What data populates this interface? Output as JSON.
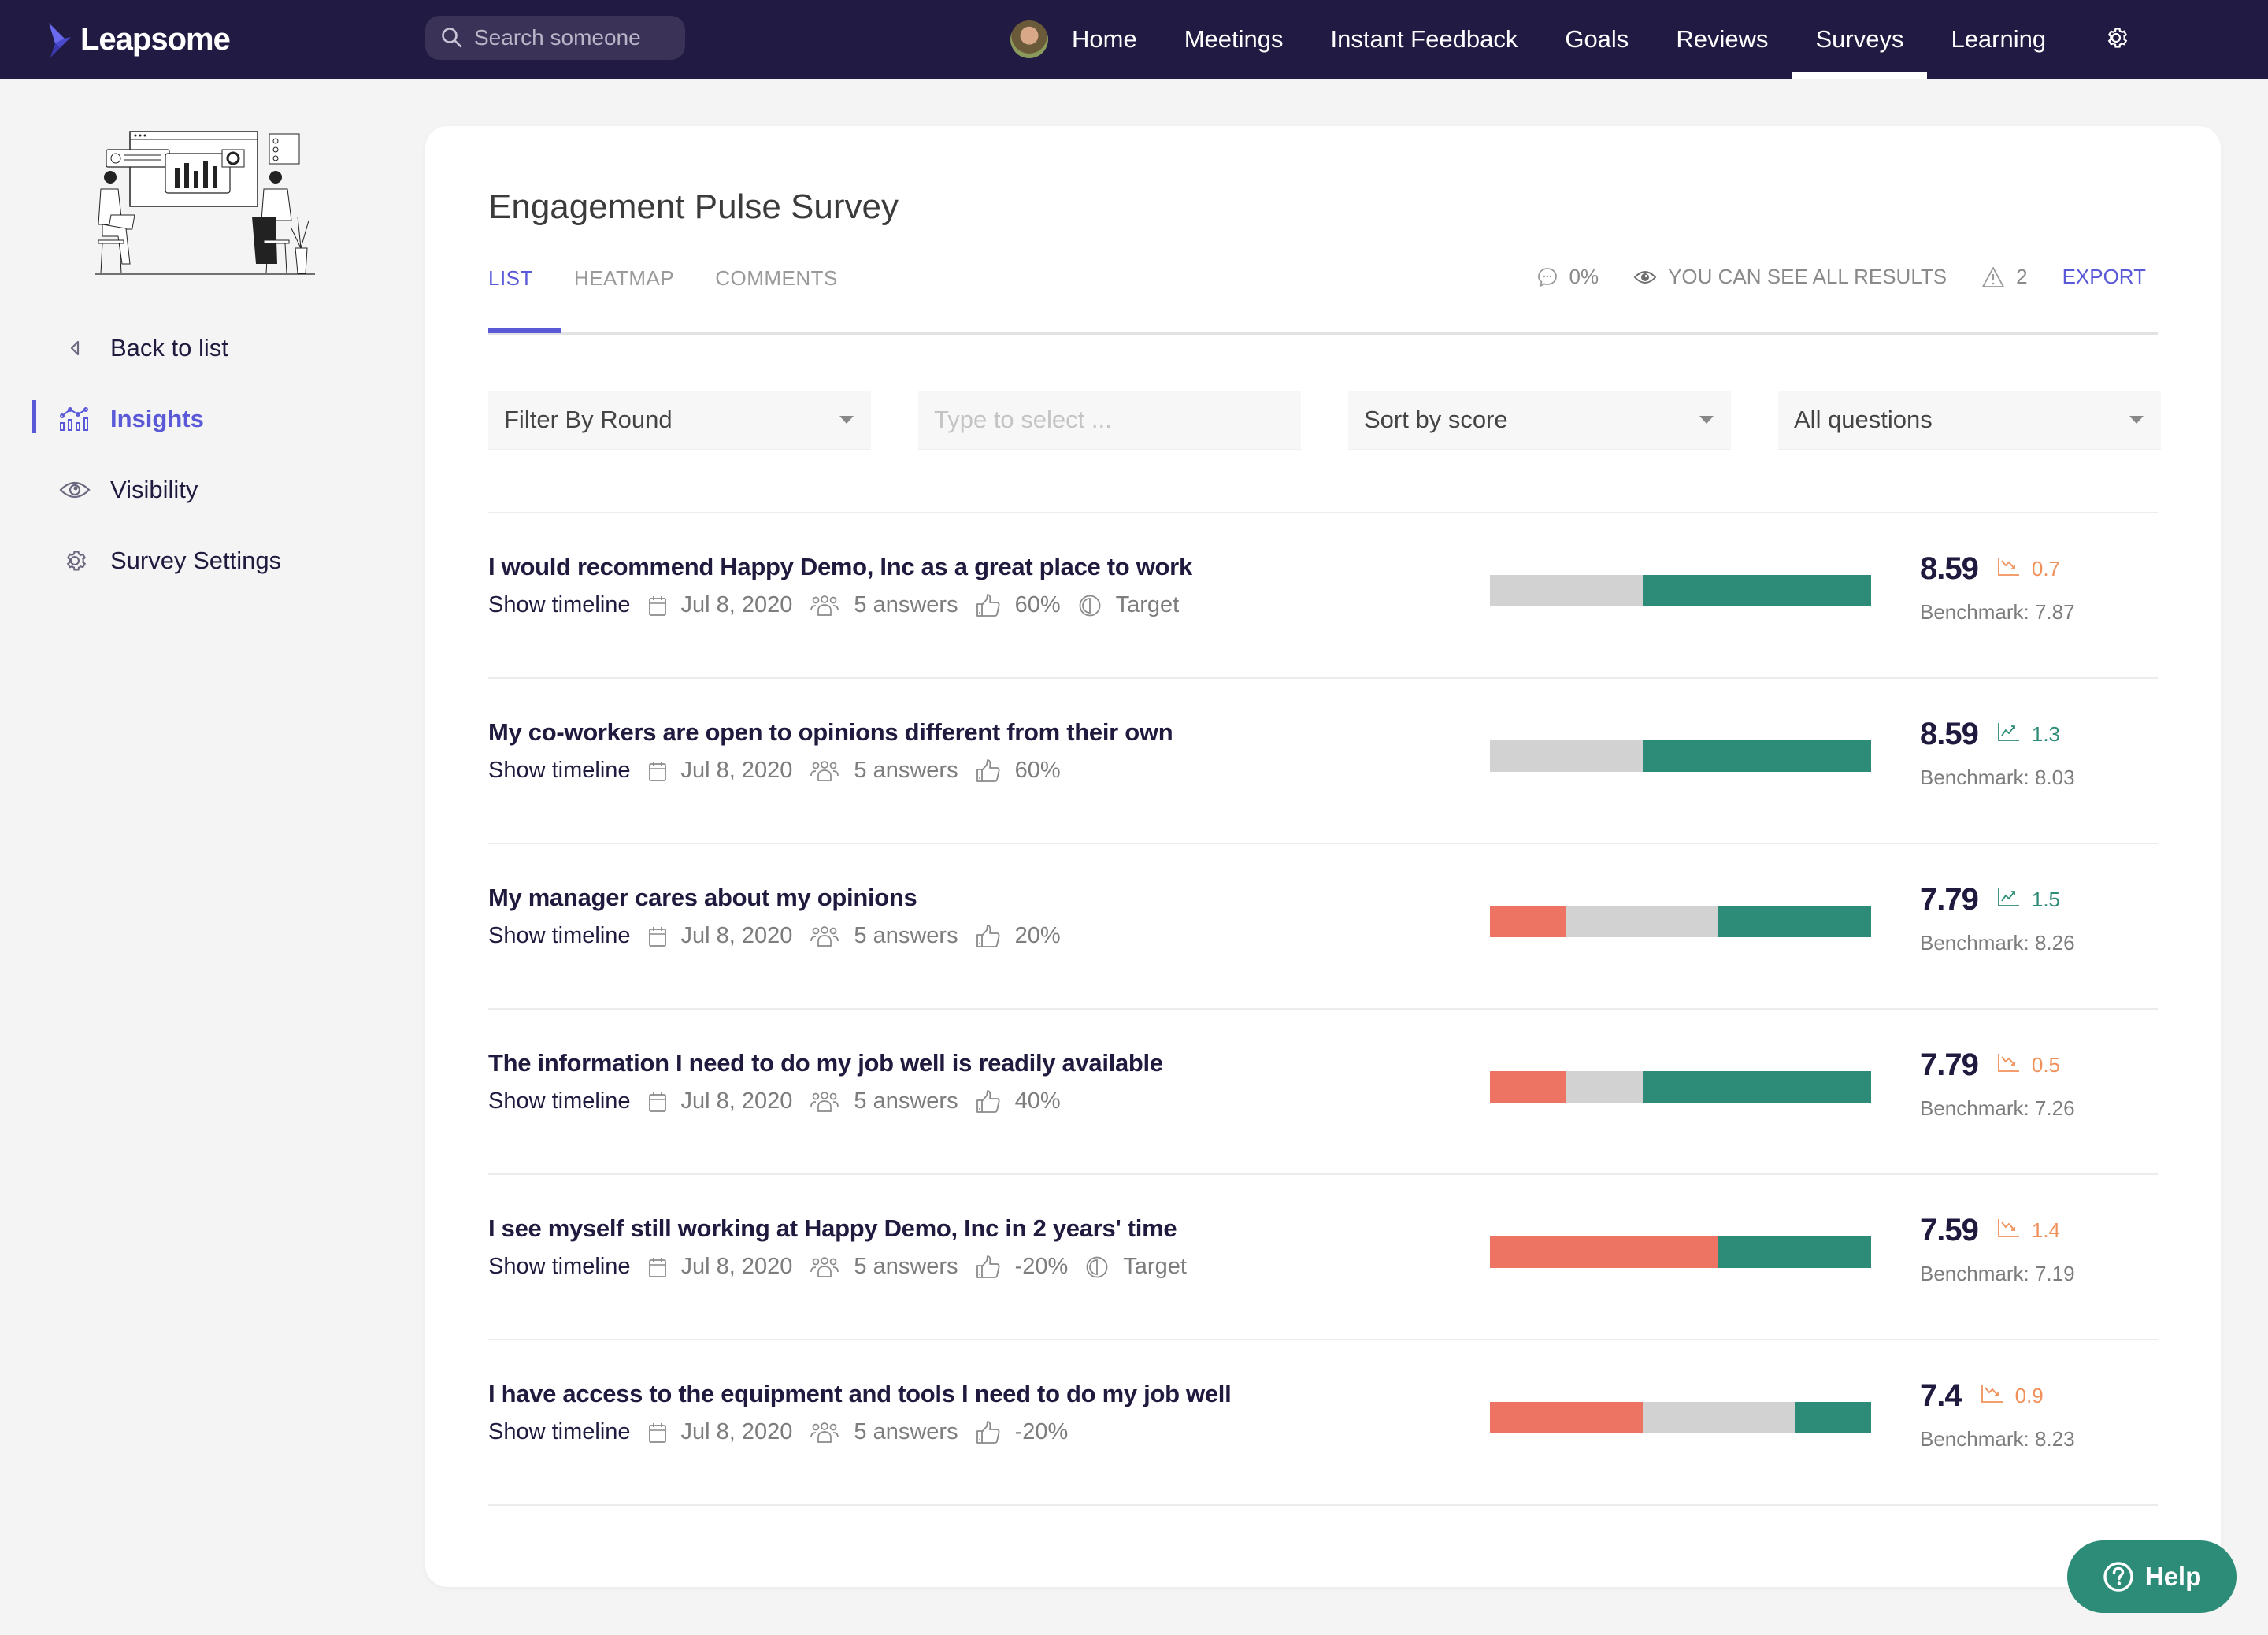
{
  "app": {
    "brand": "Leapsome",
    "search_placeholder": "Search someone",
    "nav": [
      {
        "label": "Home",
        "active": false
      },
      {
        "label": "Meetings",
        "active": false
      },
      {
        "label": "Instant Feedback",
        "active": false
      },
      {
        "label": "Goals",
        "active": false
      },
      {
        "label": "Reviews",
        "active": false
      },
      {
        "label": "Surveys",
        "active": true
      },
      {
        "label": "Learning",
        "active": false
      }
    ],
    "settings_icon": "gear-icon"
  },
  "sidebar": {
    "items": [
      {
        "label": "Back to list",
        "icon": "triangle-left-icon",
        "active": false
      },
      {
        "label": "Insights",
        "icon": "chart-icon",
        "active": true
      },
      {
        "label": "Visibility",
        "icon": "eye-icon",
        "active": false
      },
      {
        "label": "Survey Settings",
        "icon": "gear-icon",
        "active": false
      }
    ]
  },
  "survey": {
    "title": "Engagement Pulse Survey",
    "tabs": [
      {
        "label": "LIST",
        "active": true
      },
      {
        "label": "HEATMAP",
        "active": false
      },
      {
        "label": "COMMENTS",
        "active": false
      }
    ],
    "comment_rate": "0%",
    "visibility_text": "YOU CAN SEE ALL RESULTS",
    "warnings_count": "2",
    "export_label": "EXPORT"
  },
  "filters": {
    "round": "Filter By Round",
    "select_placeholder": "Type to select ...",
    "sort": "Sort by score",
    "questions": "All questions"
  },
  "questions": [
    {
      "text": "I would recommend Happy Demo, Inc as a great place to work",
      "show_timeline": "Show timeline",
      "date": "Jul 8, 2020",
      "answers": "5 answers",
      "favorability": "60%",
      "target": "Target",
      "score": "8.59",
      "trend": "down",
      "delta": "0.7",
      "benchmark": "Benchmark: 7.87",
      "distribution": {
        "negative": 0,
        "neutral": 40,
        "positive": 60
      }
    },
    {
      "text": "My co-workers are open to opinions different from their own",
      "show_timeline": "Show timeline",
      "date": "Jul 8, 2020",
      "answers": "5 answers",
      "favorability": "60%",
      "target": null,
      "score": "8.59",
      "trend": "up",
      "delta": "1.3",
      "benchmark": "Benchmark: 8.03",
      "distribution": {
        "negative": 0,
        "neutral": 40,
        "positive": 60
      }
    },
    {
      "text": "My manager cares about my opinions",
      "show_timeline": "Show timeline",
      "date": "Jul 8, 2020",
      "answers": "5 answers",
      "favorability": "20%",
      "target": null,
      "score": "7.79",
      "trend": "up",
      "delta": "1.5",
      "benchmark": "Benchmark: 8.26",
      "distribution": {
        "negative": 20,
        "neutral": 40,
        "positive": 40
      }
    },
    {
      "text": "The information I need to do my job well is readily available",
      "show_timeline": "Show timeline",
      "date": "Jul 8, 2020",
      "answers": "5 answers",
      "favorability": "40%",
      "target": null,
      "score": "7.79",
      "trend": "down",
      "delta": "0.5",
      "benchmark": "Benchmark: 7.26",
      "distribution": {
        "negative": 20,
        "neutral": 20,
        "positive": 60
      }
    },
    {
      "text": "I see myself still working at Happy Demo, Inc in 2 years' time",
      "show_timeline": "Show timeline",
      "date": "Jul 8, 2020",
      "answers": "5 answers",
      "favorability": "-20%",
      "target": "Target",
      "score": "7.59",
      "trend": "down",
      "delta": "1.4",
      "benchmark": "Benchmark: 7.19",
      "distribution": {
        "negative": 60,
        "neutral": 0,
        "positive": 40
      }
    },
    {
      "text": "I have access to the equipment and tools I need to do my job well",
      "show_timeline": "Show timeline",
      "date": "Jul 8, 2020",
      "answers": "5 answers",
      "favorability": "-20%",
      "target": null,
      "score": "7.4",
      "trend": "down",
      "delta": "0.9",
      "benchmark": "Benchmark: 8.23",
      "distribution": {
        "negative": 40,
        "neutral": 40,
        "positive": 20
      }
    }
  ],
  "colors": {
    "nav_bg": "#211a42",
    "accent": "#5a5ad8",
    "positive": "#2d8c77",
    "neutral": "#d2d2d2",
    "negative": "#ed7363",
    "trend_down": "#f0905a"
  },
  "help": {
    "label": "Help"
  }
}
